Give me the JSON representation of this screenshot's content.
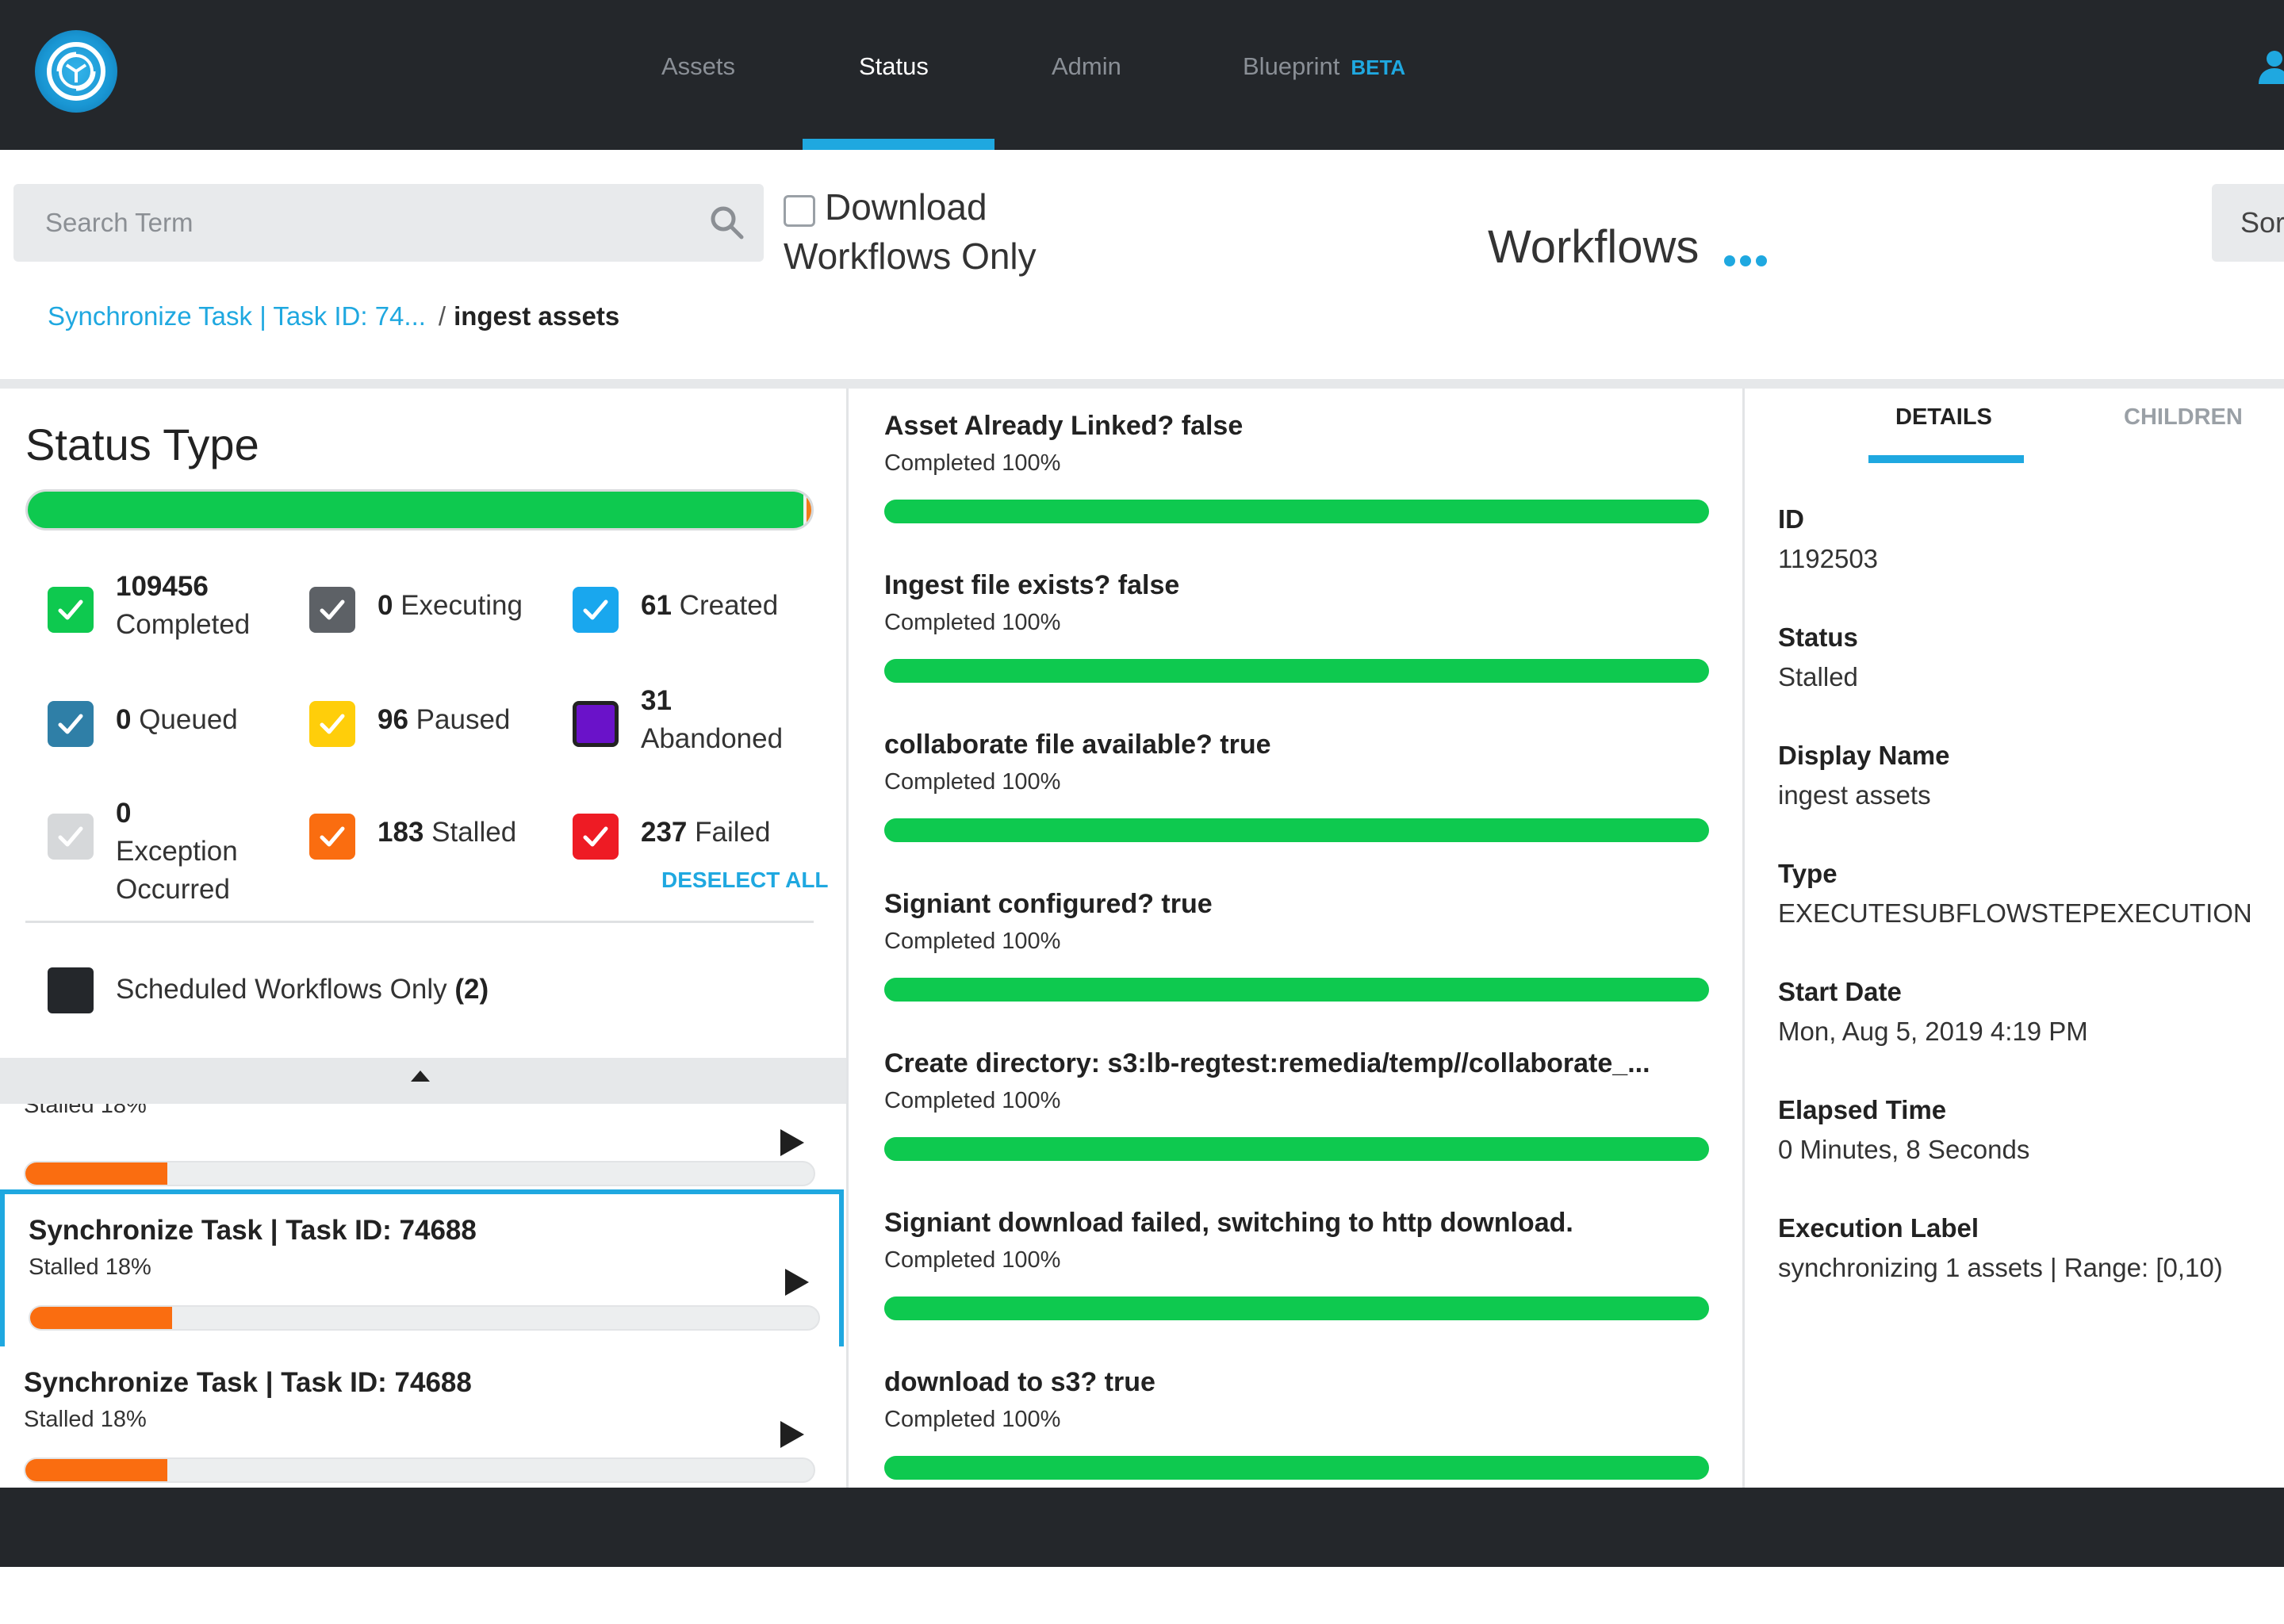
{
  "nav": {
    "items": [
      {
        "label": "Assets",
        "active": false
      },
      {
        "label": "Status",
        "active": true
      },
      {
        "label": "Admin",
        "active": false
      },
      {
        "label": "Blueprint",
        "active": false,
        "badge": "BETA"
      }
    ],
    "logo_icon": "globe-sync-icon",
    "user_icon": "user-icon"
  },
  "toolbar": {
    "search_placeholder": "Search Term",
    "download_only_label": "Download Workflows Only",
    "download_only_checked": false,
    "title": "Workflows",
    "sort_label": "Sor"
  },
  "breadcrumb": {
    "link": "Synchronize Task | Task ID: 74...",
    "separator": "/",
    "current": "ingest assets"
  },
  "status_panel": {
    "title": "Status Type",
    "progress_fraction": 0.99,
    "types": [
      {
        "count": "109456",
        "label": "Completed",
        "color": "#0ec94f",
        "checked": true
      },
      {
        "count": "0",
        "label": "Executing",
        "color": "#5d6166",
        "checked": true
      },
      {
        "count": "61",
        "label": "Created",
        "color": "#19a7ee",
        "checked": true
      },
      {
        "count": "0",
        "label": "Queued",
        "color": "#2f7fa7",
        "checked": true
      },
      {
        "count": "96",
        "label": "Paused",
        "color": "#ffce0a",
        "checked": true
      },
      {
        "count": "31",
        "label": "Abandoned",
        "color": "#6a12c9",
        "checked": false
      },
      {
        "count": "0",
        "label": "Exception Occurred",
        "color": "#d6d8da",
        "checked": true
      },
      {
        "count": "183",
        "label": "Stalled",
        "color": "#fa6d10",
        "checked": true
      },
      {
        "count": "237",
        "label": "Failed",
        "color": "#ee1b24",
        "checked": true
      }
    ],
    "deselect_all": "DESELECT ALL",
    "scheduled_label": "Scheduled Workflows Only",
    "scheduled_count": "(2)"
  },
  "tasks": [
    {
      "title": "",
      "status": "Stalled 18%",
      "progress": 0.18,
      "partial": true
    },
    {
      "title": "Synchronize Task | Task ID: 74688",
      "status": "Stalled 18%",
      "progress": 0.18,
      "selected": true
    },
    {
      "title": "Synchronize Task | Task ID: 74688",
      "status": "Stalled 18%",
      "progress": 0.18
    }
  ],
  "steps": [
    {
      "title": "Asset Already Linked? false",
      "status": "Completed 100%",
      "progress": 1.0
    },
    {
      "title": "Ingest file exists? false",
      "status": "Completed 100%",
      "progress": 1.0
    },
    {
      "title": "collaborate file available? true",
      "status": "Completed 100%",
      "progress": 1.0
    },
    {
      "title": "Signiant configured? true",
      "status": "Completed 100%",
      "progress": 1.0
    },
    {
      "title": "Create directory: s3:lb-regtest:remedia/temp//collaborate_...",
      "status": "Completed 100%",
      "progress": 1.0
    },
    {
      "title": "Signiant download failed, switching to http download.",
      "status": "Completed 100%",
      "progress": 1.0
    },
    {
      "title": "download to s3? true",
      "status": "Completed 100%",
      "progress": 1.0
    }
  ],
  "details": {
    "tabs": [
      {
        "label": "DETAILS",
        "active": true
      },
      {
        "label": "CHILDREN",
        "active": false
      }
    ],
    "fields": [
      {
        "label": "ID",
        "value": "1192503"
      },
      {
        "label": "Status",
        "value": "Stalled"
      },
      {
        "label": "Display Name",
        "value": "ingest assets"
      },
      {
        "label": "Type",
        "value": "EXECUTESUBFLOWSTEPEXECUTION"
      },
      {
        "label": "Start Date",
        "value": "Mon, Aug 5, 2019 4:19 PM"
      },
      {
        "label": "Elapsed Time",
        "value": "0 Minutes, 8 Seconds"
      },
      {
        "label": "Execution Label",
        "value": "synchronizing 1 assets | Range: [0,10)"
      }
    ]
  }
}
